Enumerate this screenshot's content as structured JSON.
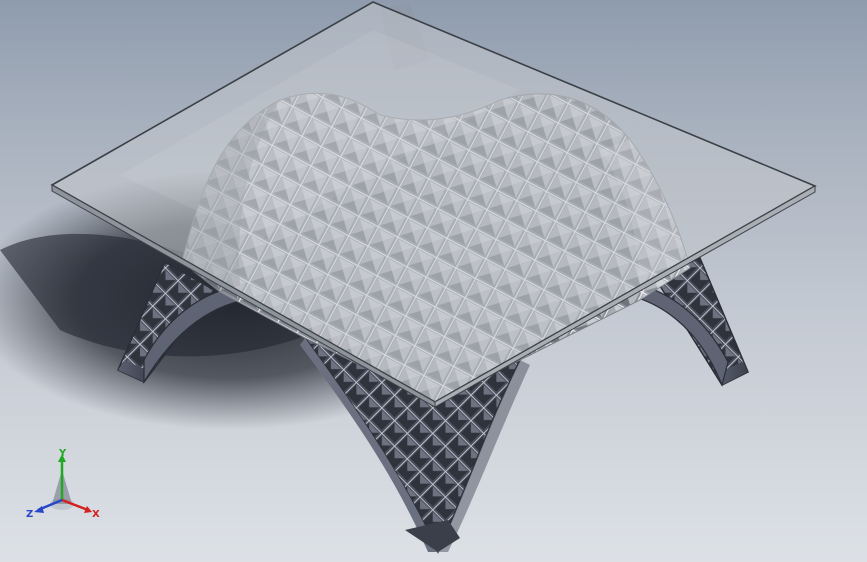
{
  "viewport": {
    "background_top": "#8f9cae",
    "background_bottom": "#dde1e6"
  },
  "model": {
    "glass_color": "#b4b9bf",
    "glass_edge_color": "#3c4148",
    "frame_color": "#606776",
    "frame_dark": "#3b404b",
    "lattice_light": "#e9ebf0"
  },
  "triad": {
    "x_label": "X",
    "y_label": "Y",
    "z_label": "Z",
    "x_color": "#d42020",
    "y_color": "#22a822",
    "z_color": "#2846c8"
  }
}
